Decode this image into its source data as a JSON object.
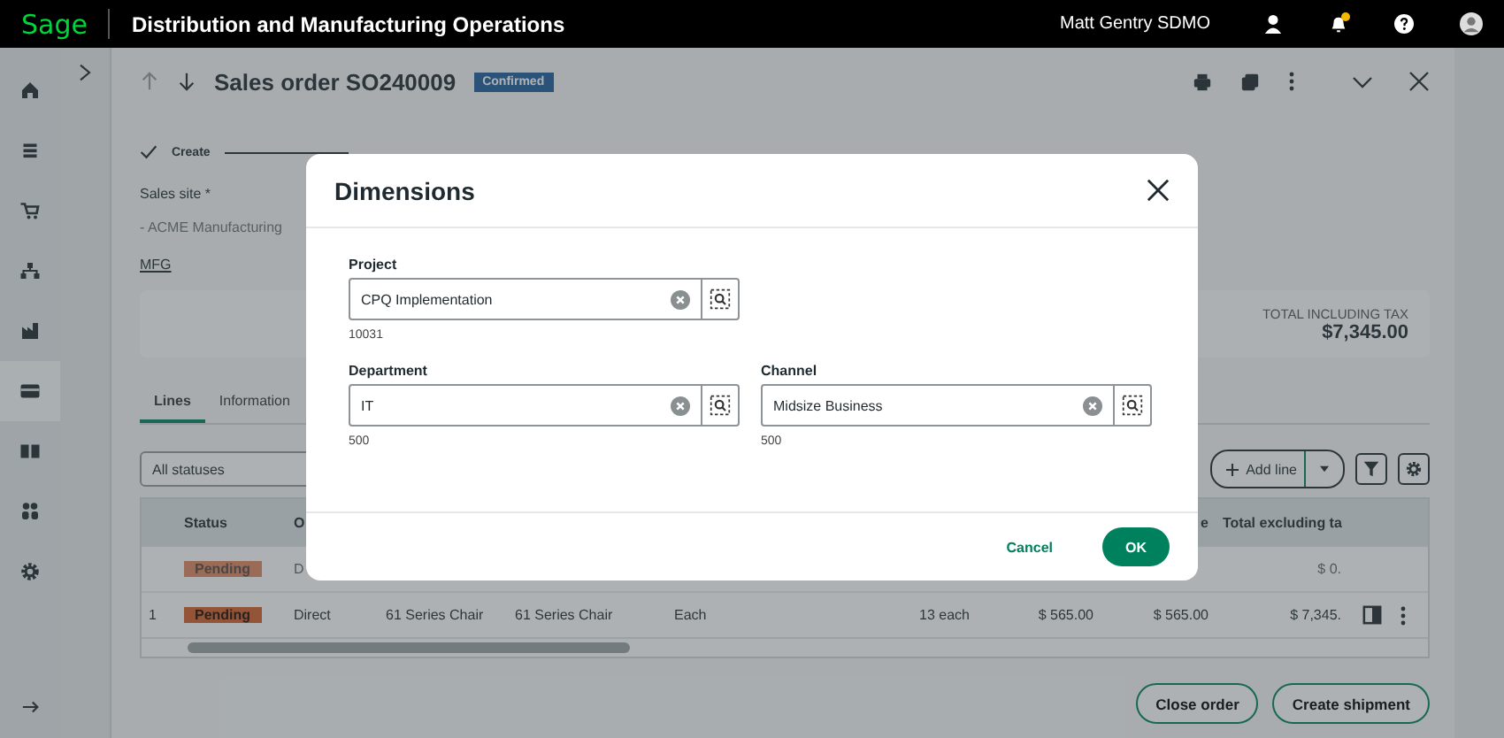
{
  "top_bar": {
    "logo": "Sage",
    "title": "Distribution and Manufacturing Operations",
    "user": "Matt Gentry SDMO",
    "notification": true
  },
  "nav": [
    {
      "kind": "home",
      "selected": false
    },
    {
      "kind": "list",
      "selected": false
    },
    {
      "kind": "cart",
      "selected": false
    },
    {
      "kind": "hierarchy",
      "selected": false
    },
    {
      "kind": "factory",
      "selected": false
    },
    {
      "kind": "card",
      "selected": true
    },
    {
      "kind": "book",
      "selected": false
    },
    {
      "kind": "people",
      "selected": false
    },
    {
      "kind": "gear",
      "selected": false
    }
  ],
  "record": {
    "title": "Sales order SO240009",
    "status": "Confirmed"
  },
  "steps": [
    {
      "label": "Create",
      "done": true
    }
  ],
  "sales_site": {
    "label": "Sales site *",
    "placeholder": "- ACME Manufacturing",
    "link": "MFG"
  },
  "totals": {
    "label": "TOTAL INCLUDING TAX",
    "value": "$7,345.00"
  },
  "tabs": [
    {
      "label": "Lines",
      "selected": true
    },
    {
      "label": "Information",
      "selected": false
    }
  ],
  "lines": {
    "filter": "All statuses",
    "add_button": "Add line",
    "header": {
      "column_2": "Status",
      "column_3": "O",
      "column_9": "e",
      "column_10": "Total excluding ta"
    },
    "rows": [
      {
        "kind": "draft",
        "cells": {
          "column_2": "Pending",
          "column_3": "D",
          "column_10": "$ 0."
        }
      },
      {
        "kind": "line",
        "cells": {
          "column_1": "1",
          "column_2": "Pending",
          "column_3": "Direct",
          "column_4": "61 Series Chair",
          "column_5": "61 Series Chair",
          "column_6": "Each",
          "column_7": "13 each",
          "column_8": "$ 565.00",
          "column_9": "$ 565.00",
          "column_10": "$ 7,345."
        }
      }
    ]
  },
  "footer_buttons": [
    "Close order",
    "Create shipment"
  ],
  "dialog": {
    "title": "Dimensions",
    "rows": [
      [
        {
          "label": "Project",
          "value": "CPQ Implementation",
          "code": "10031"
        }
      ],
      [
        {
          "label": "Department",
          "value": "IT",
          "code": "500"
        },
        {
          "label": "Channel",
          "value": "Midsize Business",
          "code": "500"
        }
      ]
    ],
    "cancel": "Cancel",
    "ok": "OK"
  }
}
